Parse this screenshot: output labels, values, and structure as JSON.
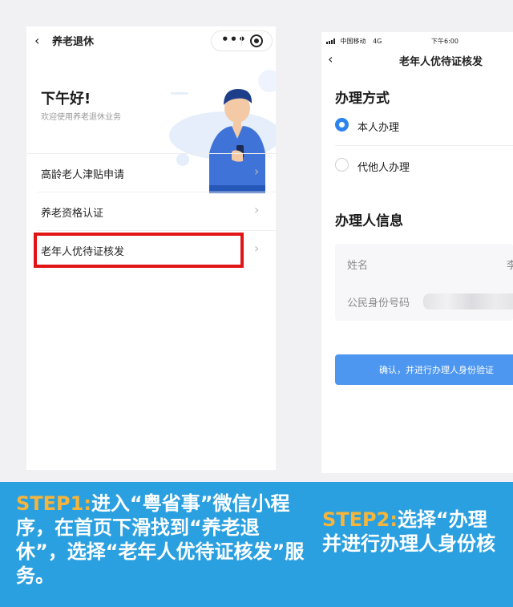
{
  "phone1": {
    "title": "养老退休",
    "back_icon": "chevron-left-icon",
    "more_icon": "more-dots-icon",
    "close_icon": "mini-program-close-icon",
    "greeting": "下午好!",
    "welcome": "欢迎使用养老退休业务",
    "menu": [
      {
        "label": "高龄老人津贴申请"
      },
      {
        "label": "养老资格认证"
      },
      {
        "label": "老年人优待证核发"
      }
    ],
    "highlight_color": "#e01515"
  },
  "phone2": {
    "status_carrier": "中国移动",
    "status_network": "4G",
    "status_time": "下午6:00",
    "title": "老年人优待证核发",
    "section_method": "办理方式",
    "options": [
      {
        "label": "本人办理",
        "selected": true
      },
      {
        "label": "代他人办理",
        "selected": false
      }
    ],
    "section_info": "办理人信息",
    "field_name_label": "姓名",
    "field_name_value": "李",
    "field_id_label": "公民身份号码",
    "confirm_label": "确认，并进行办理人身份验证",
    "accent": "#4d97f0"
  },
  "banner": {
    "step1_label": "STEP1:",
    "step1_text": "进入“粤省事”微信小程序，在首页下滑找到“养老退休”，选择“老年人优待证核发”服务。",
    "step2_label": "STEP2:",
    "step2_line1": "选择“办理",
    "step2_line2": "并进行办理人身份核",
    "background": "#2aa0e0",
    "label_color": "#f6b53a"
  }
}
